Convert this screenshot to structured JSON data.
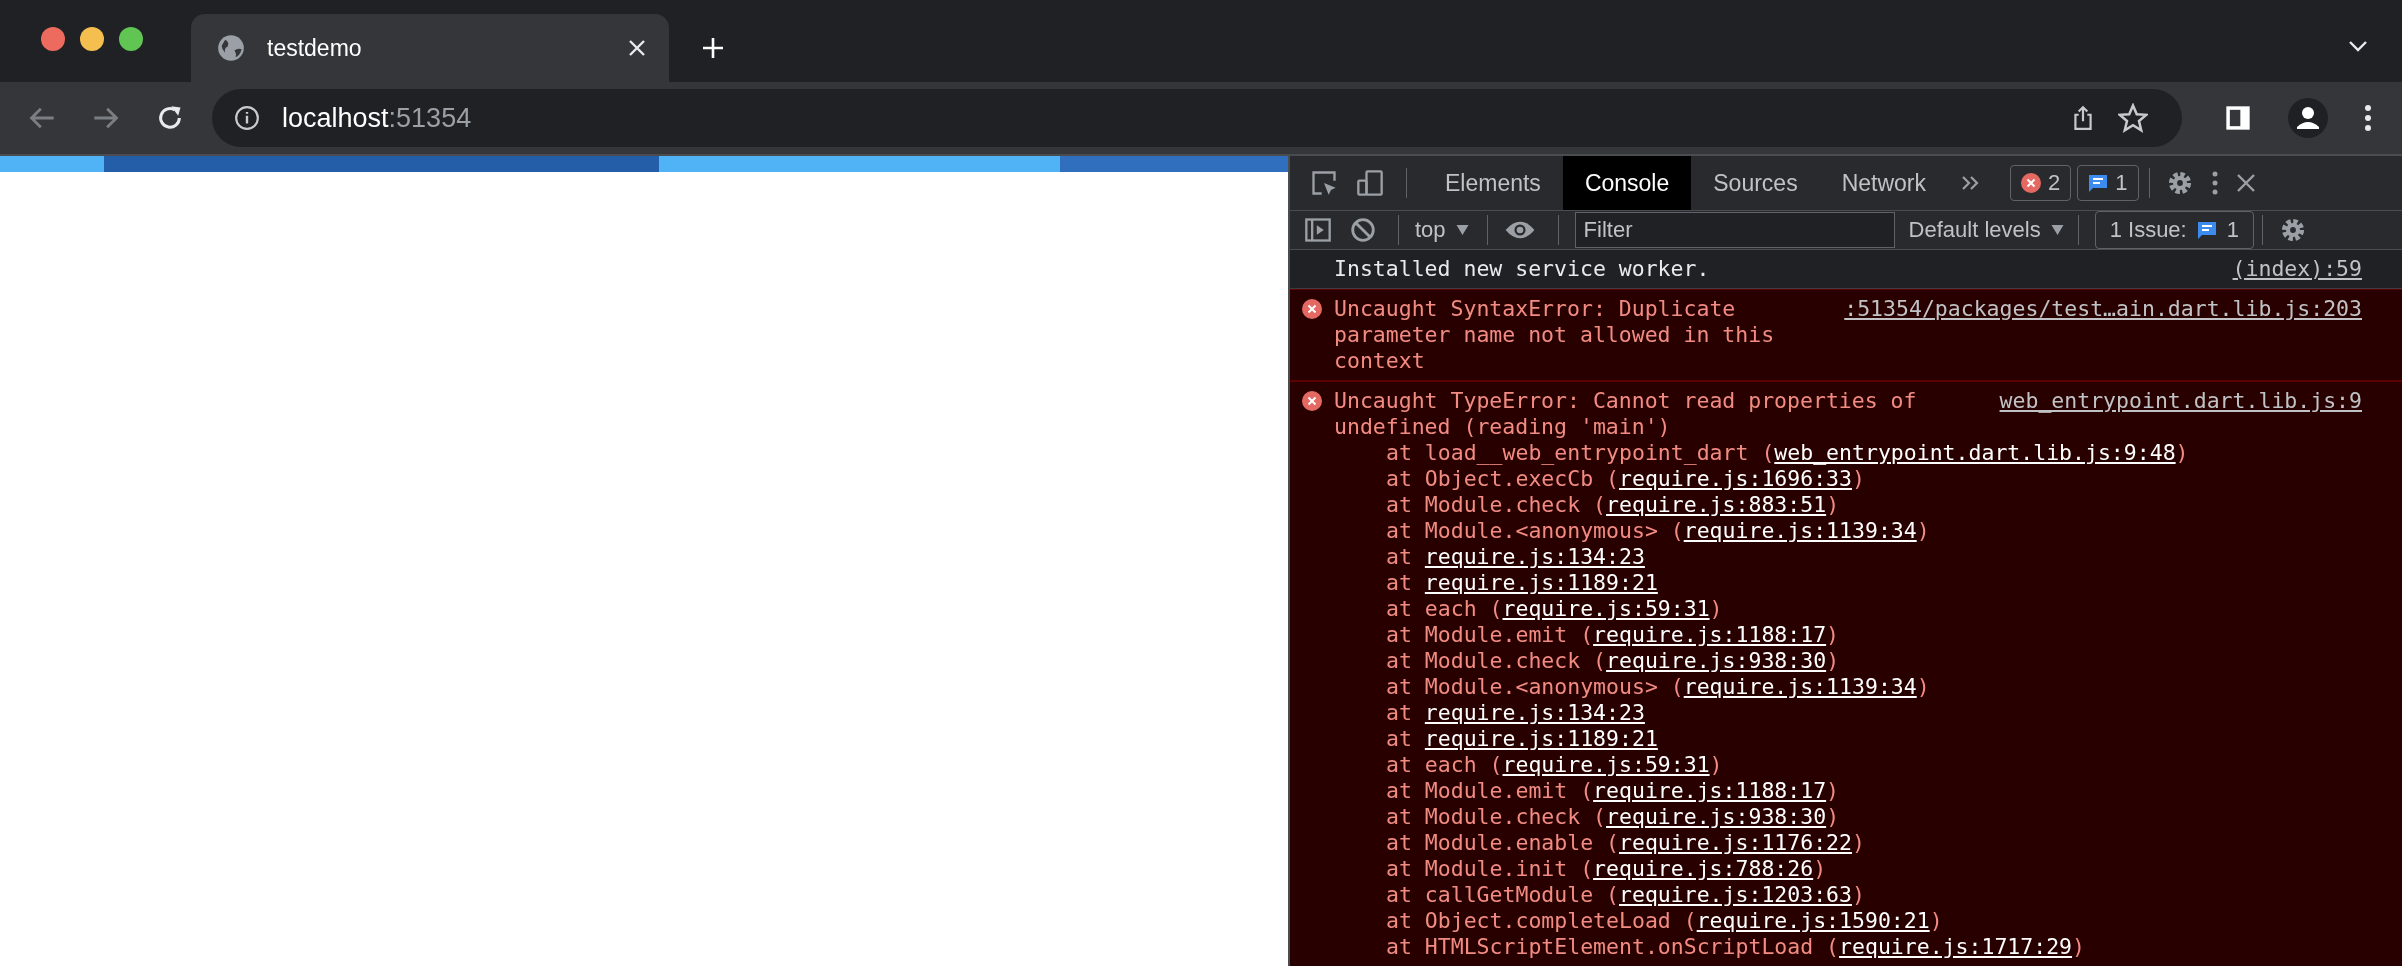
{
  "browser": {
    "tabs": [
      {
        "title": "testdemo",
        "selected": true
      }
    ],
    "address": {
      "host": "localhost",
      "port": ":51354"
    }
  },
  "devtools": {
    "tabs": [
      {
        "label": "Elements",
        "selected": false
      },
      {
        "label": "Console",
        "selected": true
      },
      {
        "label": "Sources",
        "selected": false
      },
      {
        "label": "Network",
        "selected": false
      }
    ],
    "error_count": "2",
    "message_count": "1",
    "context": "top",
    "filter": {
      "placeholder": "Filter"
    },
    "levels": "Default levels",
    "issues": {
      "label": "1 Issue:",
      "count": "1"
    },
    "messages": [
      {
        "kind": "info",
        "text": "Installed new service worker.",
        "source": "(index):59"
      },
      {
        "kind": "error",
        "text": "Uncaught SyntaxError: Duplicate\nparameter name not allowed in this context",
        "source": ":51354/packages/test…ain.dart.lib.js:203"
      },
      {
        "kind": "error",
        "text": "Uncaught TypeError: Cannot read properties of\nundefined (reading 'main')",
        "source": "web_entrypoint.dart.lib.js:9",
        "stack": [
          {
            "before": "at load__web_entrypoint_dart (",
            "link": "web_entrypoint.dart.lib.js:9:48",
            "after": ")"
          },
          {
            "before": "at Object.execCb (",
            "link": "require.js:1696:33",
            "after": ")"
          },
          {
            "before": "at Module.check (",
            "link": "require.js:883:51",
            "after": ")"
          },
          {
            "before": "at Module.<anonymous> (",
            "link": "require.js:1139:34",
            "after": ")"
          },
          {
            "before": "at ",
            "link": "require.js:134:23"
          },
          {
            "before": "at ",
            "link": "require.js:1189:21"
          },
          {
            "before": "at each (",
            "link": "require.js:59:31",
            "after": ")"
          },
          {
            "before": "at Module.emit (",
            "link": "require.js:1188:17",
            "after": ")"
          },
          {
            "before": "at Module.check (",
            "link": "require.js:938:30",
            "after": ")"
          },
          {
            "before": "at Module.<anonymous> (",
            "link": "require.js:1139:34",
            "after": ")"
          },
          {
            "before": "at ",
            "link": "require.js:134:23"
          },
          {
            "before": "at ",
            "link": "require.js:1189:21"
          },
          {
            "before": "at each (",
            "link": "require.js:59:31",
            "after": ")"
          },
          {
            "before": "at Module.emit (",
            "link": "require.js:1188:17",
            "after": ")"
          },
          {
            "before": "at Module.check (",
            "link": "require.js:938:30",
            "after": ")"
          },
          {
            "before": "at Module.enable (",
            "link": "require.js:1176:22",
            "after": ")"
          },
          {
            "before": "at Module.init (",
            "link": "require.js:788:26",
            "after": ")"
          },
          {
            "before": "at callGetModule (",
            "link": "require.js:1203:63",
            "after": ")"
          },
          {
            "before": "at Object.completeLoad (",
            "link": "require.js:1590:21",
            "after": ")"
          },
          {
            "before": "at HTMLScriptElement.onScriptLoad (",
            "link": "require.js:1717:29",
            "after": ")"
          }
        ]
      }
    ]
  }
}
